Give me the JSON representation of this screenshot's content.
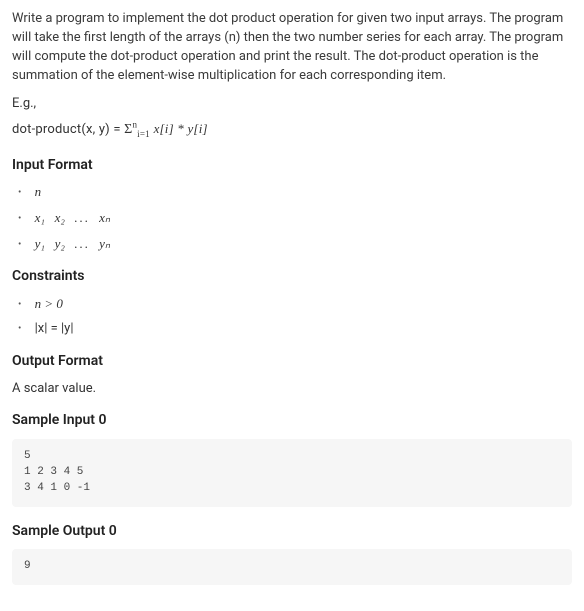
{
  "intro": "Write a program to implement the dot product operation for given two input arrays. The program will take the first length of the arrays (n) then the two number series for each array. The program will compute the dot-product operation and print the result. The dot-product operation is the summation of the element-wise multiplication for each corresponding item.",
  "eg_label": "E.g.,",
  "formula_text": "dot-product(x, y) = Σⁿᵢ₌₁ x[i] * y[i]",
  "formula": {
    "lhs": "dot-product(x, y) =",
    "sum_symbol": "Σ",
    "sum_upper": "n",
    "sum_lower": "i=1",
    "body": "x[i] * y[i]"
  },
  "sections": {
    "input_format": "Input Format",
    "constraints": "Constraints",
    "output_format": "Output Format",
    "sample_input_0": "Sample Input 0",
    "sample_output_0": "Sample Output 0"
  },
  "input_list": {
    "n": "n",
    "x_first": "x₁",
    "x_second": "x₂",
    "dots": "...",
    "x_last": "xₙ",
    "y_first": "y₁",
    "y_second": "y₂",
    "y_last": "yₙ"
  },
  "constraints_list": {
    "c1": "n > 0",
    "c2": "|x| = |y|"
  },
  "output_desc": "A scalar value.",
  "sample_input_0_code": "5\n1 2 3 4 5\n3 4 1 0 -1",
  "sample_output_0_code": "9"
}
